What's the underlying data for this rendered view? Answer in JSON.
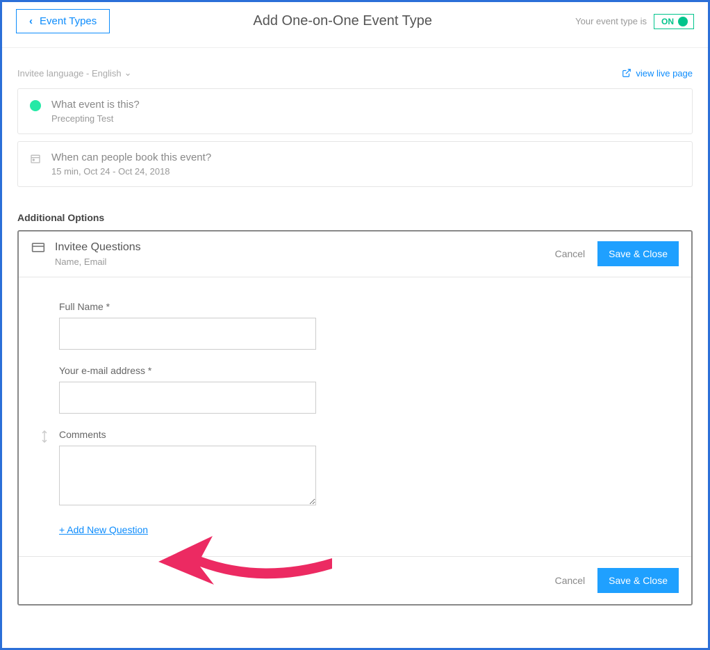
{
  "header": {
    "back_label": "Event Types",
    "title": "Add One-on-One Event Type",
    "status_text": "Your event type is",
    "toggle_label": "ON"
  },
  "subheader": {
    "language_label": "Invitee language - English",
    "live_link_label": "view live page"
  },
  "cards": [
    {
      "title": "What event is this?",
      "subtitle": "Precepting Test",
      "icon": "green-dot"
    },
    {
      "title": "When can people book this event?",
      "subtitle": "15 min, Oct 24 - Oct 24, 2018",
      "icon": "calendar"
    }
  ],
  "section_label": "Additional Options",
  "questions_panel": {
    "title": "Invitee Questions",
    "subtitle": "Name, Email",
    "cancel_label": "Cancel",
    "save_label": "Save & Close",
    "fields": [
      {
        "label": "Full Name *",
        "type": "text",
        "draggable": false
      },
      {
        "label": "Your e-mail address *",
        "type": "text",
        "draggable": false
      },
      {
        "label": "Comments",
        "type": "textarea",
        "draggable": true
      }
    ],
    "add_question_label": "+ Add New Question"
  }
}
